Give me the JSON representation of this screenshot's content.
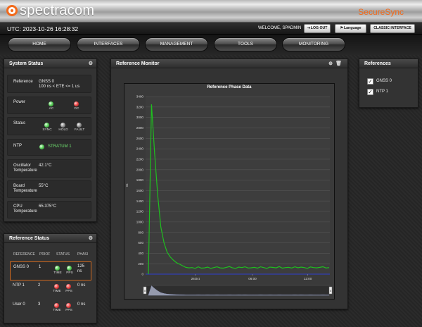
{
  "header": {
    "brand": "spectracom",
    "product": "SecureSync",
    "utc": "UTC: 2023-10-26 16:28:32",
    "welcome": "WELCOME, SPADMIN",
    "logout_label": "LOG OUT",
    "language_label": "Language",
    "classic_label": "CLASSIC INTERFACE"
  },
  "nav": {
    "items": [
      "HOME",
      "INTERFACES",
      "MANAGEMENT",
      "TOOLS",
      "MONITORING"
    ]
  },
  "system_status": {
    "title": "System Status",
    "reference": {
      "label": "Reference",
      "source": "GNSS 0",
      "detail": "100 ns < ETE <= 1 us"
    },
    "power": {
      "label": "Power",
      "ac": "AC",
      "dc": "DC",
      "ac_state": "green",
      "dc_state": "red"
    },
    "status": {
      "label": "Status",
      "sync": "SYNC",
      "hold": "HOLD",
      "fault": "FAULT",
      "sync_state": "green",
      "hold_state": "gray",
      "fault_state": "gray"
    },
    "ntp": {
      "label": "NTP",
      "value": "STRATUM 1",
      "state": "green"
    },
    "osc": {
      "label1": "Oscillator",
      "label2": "Temperature",
      "value": "42.1°C"
    },
    "board": {
      "label1": "Board",
      "label2": "Temperature",
      "value": "55°C"
    },
    "cpu": {
      "label1": "CPU",
      "label2": "Temperature",
      "value": "65.375°C"
    }
  },
  "reference_status": {
    "title": "Reference Status",
    "columns": [
      "REFERENCE",
      "PRIOF",
      "STATUS",
      "PHASI"
    ],
    "rows": [
      {
        "name": "GNSS 0",
        "priority": "1",
        "time_label": "TIME",
        "pps_label": "PPS",
        "time_state": "green",
        "pps_state": "green",
        "phase_top": "125",
        "phase_bottom": "ns"
      },
      {
        "name": "NTP 1",
        "priority": "2",
        "time_label": "TIME",
        "pps_label": "PPS",
        "time_state": "red",
        "pps_state": "red",
        "phase_top": "0 ns",
        "phase_bottom": ""
      },
      {
        "name": "User 0",
        "priority": "3",
        "time_label": "TIME",
        "pps_label": "PPS",
        "time_state": "red",
        "pps_state": "red",
        "phase_top": "0 ns",
        "phase_bottom": ""
      }
    ]
  },
  "reference_monitor": {
    "title": "Reference Monitor",
    "chart_title": "Reference Phase Data"
  },
  "references": {
    "title": "References",
    "items": [
      {
        "label": "GNSS 0",
        "checked": true
      },
      {
        "label": "NTP 1",
        "checked": true
      }
    ]
  },
  "colors": {
    "accent_orange": "#f26a1b",
    "series_green": "#1fbf1f",
    "baseline_blue": "#2f3fd0"
  },
  "chart_data": {
    "type": "line",
    "title": "Reference Phase Data",
    "xlabel": "",
    "ylabel": "ns",
    "ylim": [
      0,
      3400
    ],
    "yticks": [
      0,
      200,
      400,
      600,
      800,
      1000,
      1200,
      1400,
      1600,
      1800,
      2000,
      2200,
      2400,
      2600,
      2800,
      3000,
      3200,
      3400
    ],
    "xticks": [
      "26Oct",
      "06:00",
      "12:00"
    ],
    "grid": true,
    "series": [
      {
        "values": [
          0,
          3250,
          2300,
          1500,
          900,
          600,
          420,
          330,
          270,
          220,
          190,
          160,
          130,
          120,
          125,
          110,
          140,
          115,
          120,
          135,
          110,
          125,
          140,
          120,
          115,
          130,
          145,
          120,
          110,
          135,
          125,
          140,
          118,
          122,
          130,
          115,
          140,
          125,
          110,
          135,
          128,
          120,
          145,
          115,
          125,
          130,
          118,
          140,
          122,
          135,
          125,
          110,
          138,
          125,
          120,
          130,
          142,
          118,
          125
        ]
      }
    ],
    "navigator_left": "0",
    "navigator_right": "0"
  }
}
